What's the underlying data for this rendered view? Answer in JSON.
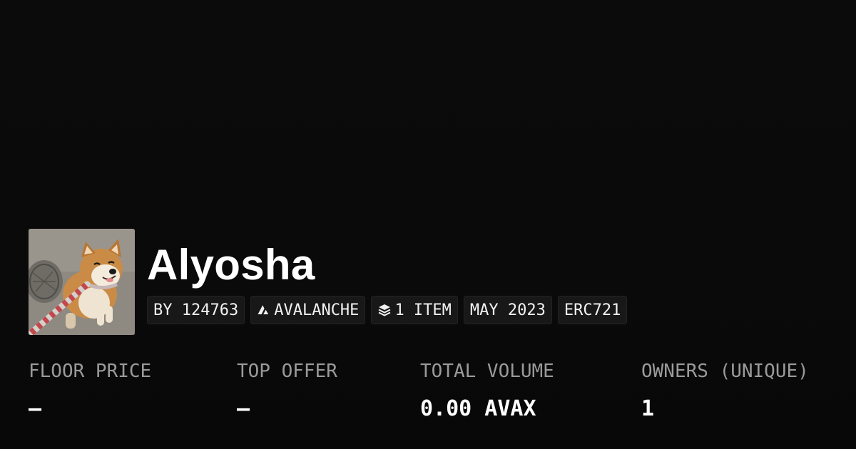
{
  "collection": {
    "name": "Alyosha",
    "avatar_description": "shiba-inu-dog-photo"
  },
  "tags": {
    "creator": "BY 124763",
    "chain": "AVALANCHE",
    "chain_icon": "avalanche-logo-icon",
    "items": "1 ITEM",
    "items_icon": "layers-icon",
    "date": "MAY 2023",
    "standard": "ERC721"
  },
  "stats": {
    "floor_price": {
      "label": "FLOOR PRICE",
      "value": "—"
    },
    "top_offer": {
      "label": "TOP OFFER",
      "value": "—"
    },
    "total_volume": {
      "label": "TOTAL VOLUME",
      "value": "0.00 AVAX"
    },
    "owners": {
      "label": "OWNERS (UNIQUE)",
      "value": "1"
    }
  },
  "colors": {
    "background": "#0b0b0b",
    "text_primary": "#ffffff",
    "text_secondary": "#9a9a9a",
    "tag_background": "#181818"
  }
}
